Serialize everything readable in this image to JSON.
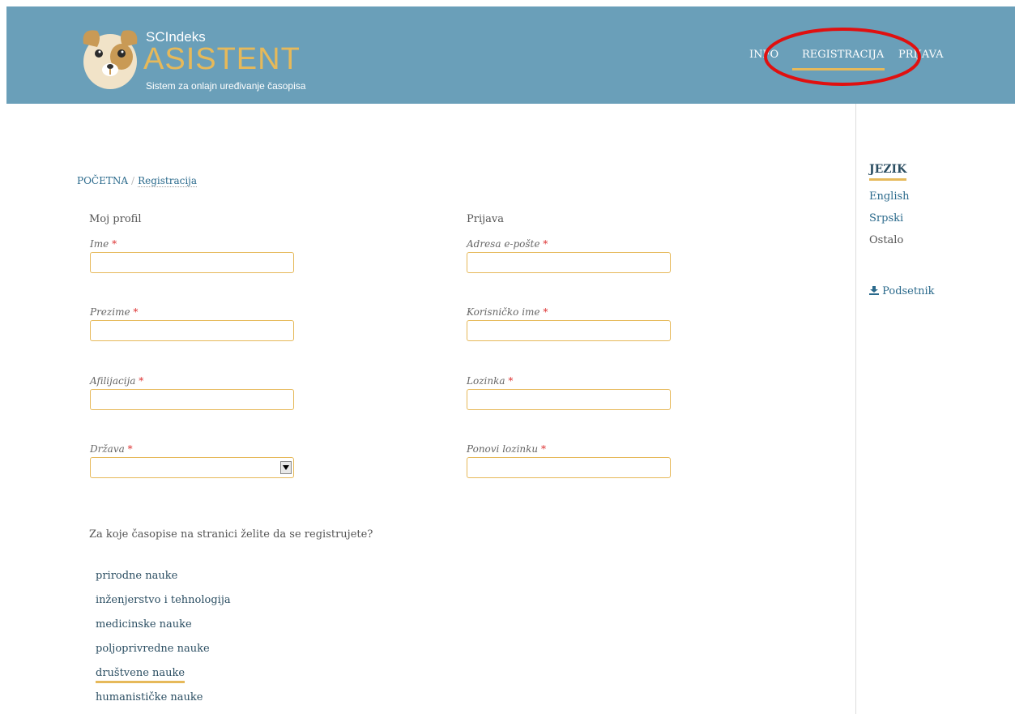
{
  "header": {
    "logo_small": "SCIndeks",
    "logo_big": "ASISTENT",
    "logo_sub": "Sistem za onlajn uređivanje časopisa",
    "nav": {
      "info": "INFO",
      "registracija": "REGISTRACIJA",
      "prijava": "PRIJAVA"
    }
  },
  "breadcrumb": {
    "home": "POČETNA",
    "separator": "/",
    "current": "Registracija"
  },
  "form": {
    "profile_title": "Moj profil",
    "login_title": "Prijava",
    "required_mark": "*",
    "fields_left": [
      {
        "label": "Ime",
        "value": ""
      },
      {
        "label": "Prezime",
        "value": ""
      },
      {
        "label": "Afilijacija",
        "value": ""
      },
      {
        "label": "Država",
        "value": ""
      }
    ],
    "fields_right": [
      {
        "label": "Adresa e-pošte",
        "value": ""
      },
      {
        "label": "Korisničko ime",
        "value": ""
      },
      {
        "label": "Lozinka",
        "value": ""
      },
      {
        "label": "Ponovi lozinku",
        "value": ""
      }
    ]
  },
  "journals": {
    "question": "Za koje časopise na stranici želite da se registrujete?",
    "items": [
      "prirodne nauke",
      "inženjerstvo i tehnologija",
      "medicinske nauke",
      "poljoprivredne nauke",
      "društvene nauke",
      "humanističke nauke"
    ],
    "active_index": 4
  },
  "sidebar": {
    "title": "JEZIK",
    "languages": [
      "English",
      "Srpski"
    ],
    "other": "Ostalo",
    "download_label": "Podsetnik",
    "download_icon": "download-icon"
  },
  "colors": {
    "header_bg": "#6a9fb9",
    "accent": "#e6b95a",
    "link": "#2b6a8c",
    "annotation": "#e01010"
  }
}
